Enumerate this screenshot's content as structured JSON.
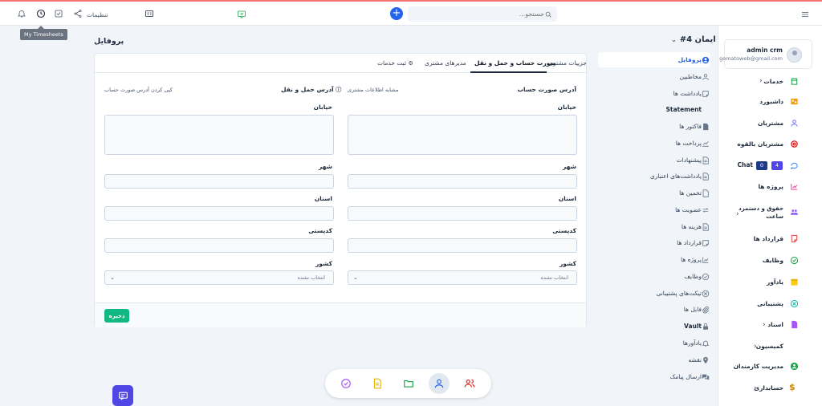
{
  "topbar": {
    "settings_label": "تنظیمات",
    "search_placeholder": "جستجو...",
    "tooltip": "My Timesheets",
    "colors": {
      "accent": "#2563eb",
      "top_border": "#f87171"
    }
  },
  "user": {
    "name": "admin crm",
    "email": "gomatoweb@gmail.com"
  },
  "main_nav": {
    "items": [
      {
        "label": "خدمات",
        "icon": "store-icon"
      },
      {
        "label": "داشبورد",
        "icon": "dashboard-icon"
      },
      {
        "label": "مشتریان",
        "icon": "user-icon"
      },
      {
        "label": "مشتریان بالقوه",
        "icon": "lifebuoy-icon"
      },
      {
        "label": "Chat",
        "icon": "chat-icon",
        "badges": [
          "4",
          "0"
        ]
      },
      {
        "label": "پروژه ها",
        "icon": "chart-icon"
      },
      {
        "label": "حقوق و دستمزد ساعت",
        "icon": "group-icon"
      },
      {
        "label": "قرارداد ها",
        "icon": "contract-icon"
      },
      {
        "label": "وظایف",
        "icon": "check-circle-icon"
      },
      {
        "label": "یادآور",
        "icon": "calendar-icon"
      },
      {
        "label": "پشتیبانی",
        "icon": "support-icon"
      },
      {
        "label": "اسناد",
        "icon": "document-icon"
      },
      {
        "label": "کمیسیون",
        "icon": ""
      },
      {
        "label": "مدیریت کارمندان",
        "icon": "employee-icon"
      },
      {
        "label": "حسابداری",
        "icon": "dollar-icon"
      }
    ]
  },
  "customer": {
    "title": "#4 ایمان",
    "subnav": [
      {
        "label": "پروفایل",
        "icon": "user-circle-icon"
      },
      {
        "label": "مخاطبین",
        "icon": "user-icon"
      },
      {
        "label": "یادداشت ها",
        "icon": "note-icon"
      },
      {
        "label": "Statement",
        "icon": ""
      },
      {
        "label": "فاکتور ها",
        "icon": "invoice-icon"
      },
      {
        "label": "پرداخت ها",
        "icon": "trend-icon"
      },
      {
        "label": "پیشنهادات",
        "icon": "file-icon"
      },
      {
        "label": "یادداشت‌های اعتباری",
        "icon": "file-icon"
      },
      {
        "label": "تخمین ها",
        "icon": "file-icon"
      },
      {
        "label": "عضویت ها",
        "icon": "repeat-icon"
      },
      {
        "label": "هزینه ها",
        "icon": "file-icon"
      },
      {
        "label": "قرارداد ها",
        "icon": "contract-icon"
      },
      {
        "label": "پروژه ها",
        "icon": "chart-icon"
      },
      {
        "label": "وظایف",
        "icon": "check-circle-icon"
      },
      {
        "label": "تیکت‌های پشتیبانی",
        "icon": "support-icon"
      },
      {
        "label": "فایل ها",
        "icon": "paperclip-icon"
      },
      {
        "label": "Vault",
        "icon": "lock-icon"
      },
      {
        "label": "یادآورها",
        "icon": "bell-icon"
      },
      {
        "label": "نقشه",
        "icon": "map-pin-icon"
      },
      {
        "label": "ارسال پیامک",
        "icon": "chat-bubbles-icon"
      }
    ]
  },
  "profile": {
    "page_title": "پروفایل",
    "tabs": [
      "جزییات مشتری",
      "صورت حساب و حمل و نقل",
      "مدیرهای مشتری",
      "ثبت خدمات"
    ],
    "billing": {
      "title": "آدرس صورت حساب",
      "link": "مشابه اطلاعات مشتری",
      "street_label": "خیابان",
      "city_label": "شهر",
      "state_label": "استان",
      "zip_label": "کدپستی",
      "country_label": "کشور",
      "country_value": "انتخاب نشده"
    },
    "shipping": {
      "title": "آدرس حمل و نقل",
      "link": "کپی کردن آدرس صورت حساب",
      "street_label": "خیابان",
      "city_label": "شهر",
      "state_label": "استان",
      "zip_label": "کدپستی",
      "country_label": "کشور",
      "country_value": "انتخاب نشده"
    },
    "save_label": "ذخیره"
  }
}
